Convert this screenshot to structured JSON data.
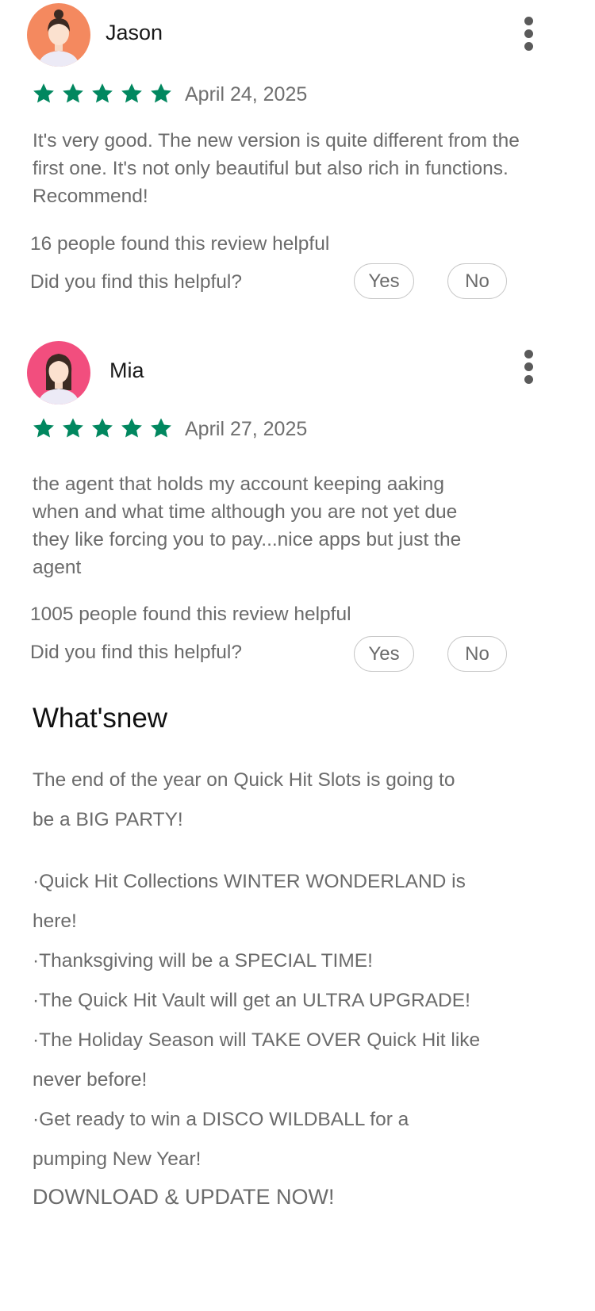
{
  "reviews": [
    {
      "name": "Jason",
      "avatar_bg": "#f4895f",
      "rating": 5,
      "date": "April 24, 2025",
      "text": "It's very good. The new version is quite different from the first one. It's not only beautiful but also rich in functions. Recommend!",
      "helpful_count_text": "16 people found this review helpful",
      "helpful_question": "Did you find this helpful?",
      "yes_label": "Yes",
      "no_label": "No"
    },
    {
      "name": "Mia",
      "avatar_bg": "#f24e7e",
      "rating": 5,
      "date": "April 27, 2025",
      "text": "the agent that holds my account keeping aaking when and what time although you are not yet due they like forcing you to pay...nice apps but just the agent",
      "helpful_count_text": "1005 people found this review helpful",
      "helpful_question": "Did you find this helpful?",
      "yes_label": "Yes",
      "no_label": "No"
    }
  ],
  "whats_new": {
    "title": "What'snew",
    "intro_line1": "The end of the year on Quick Hit Slots is going to",
    "intro_line2": "be a BIG PARTY!",
    "bullets": [
      "·Quick Hit Collections WINTER WONDERLAND is here!",
      "·Thanksgiving will be a SPECIAL TIME!",
      "·The Quick Hit Vault will get an ULTRA UPGRADE!",
      "·The Holiday Season will TAKE OVER Quick Hit like never before!",
      "·Get ready to win a DISCO WILDBALL for a pumping New Year!"
    ],
    "cta": "DOWNLOAD & UPDATE NOW!"
  },
  "colors": {
    "star": "#01875f",
    "icon_gray": "#5a5a5a",
    "text_gray": "#6b6b6b"
  },
  "icons": {
    "star": "star-icon",
    "menu": "more-vert-icon",
    "avatar": "avatar-person-icon"
  }
}
